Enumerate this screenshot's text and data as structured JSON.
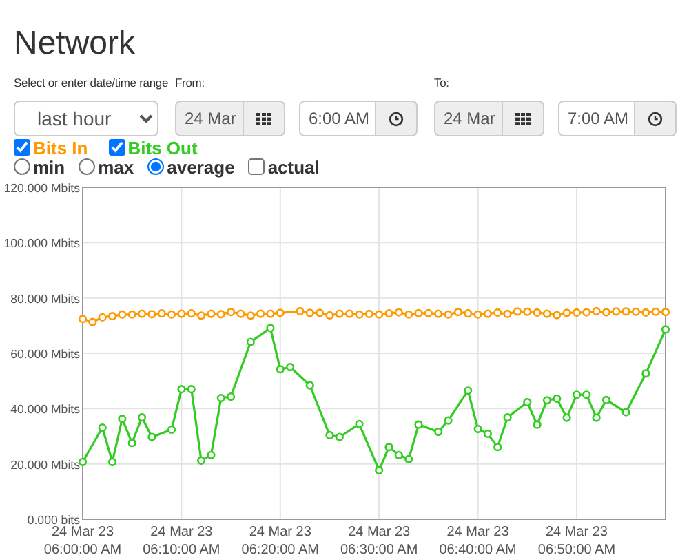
{
  "title": "Network",
  "range": {
    "label": "Select or enter date/time range",
    "value": "last hour"
  },
  "from": {
    "label": "From:",
    "date": "24 Mar",
    "time": "6:00 AM"
  },
  "to": {
    "label": "To:",
    "date": "24 Mar",
    "time": "7:00 AM"
  },
  "legend": [
    {
      "checked": true
    },
    {
      "checked": true
    }
  ],
  "modes": [
    {
      "label": "min",
      "selected": false
    },
    {
      "label": "max",
      "selected": false
    },
    {
      "label": "average",
      "selected": true
    },
    {
      "label": "actual",
      "kind": "checkbox",
      "checked": false
    }
  ],
  "chart_data": {
    "type": "line",
    "categories": [
      "24 Mar 23\n06:00:00 AM",
      null,
      null,
      null,
      null,
      null,
      null,
      null,
      null,
      null,
      "24 Mar 23\n06:10:00 AM",
      null,
      null,
      null,
      null,
      null,
      null,
      null,
      null,
      null,
      "24 Mar 23\n06:20:00 AM",
      null,
      null,
      null,
      null,
      null,
      null,
      null,
      null,
      null,
      "24 Mar 23\n06:30:00 AM",
      null,
      null,
      null,
      null,
      null,
      null,
      null,
      null,
      null,
      "24 Mar 23\n06:40:00 AM",
      null,
      null,
      null,
      null,
      null,
      null,
      null,
      null,
      null,
      "24 Mar 23\n06:50:00 AM",
      null,
      null,
      null,
      null,
      null,
      null,
      null,
      null,
      null
    ],
    "ylim": [
      0,
      120
    ],
    "grid": true,
    "yticks": [
      {
        "value": 0,
        "label": "0.000 bits"
      },
      {
        "value": 20,
        "label": "20.000 Mbits"
      },
      {
        "value": 40,
        "label": "40.000 Mbits"
      },
      {
        "value": 60,
        "label": "60.000 Mbits"
      },
      {
        "value": 80,
        "label": "80.000 Mbits"
      },
      {
        "value": 100,
        "label": "100.000 Mbits"
      },
      {
        "value": 120,
        "label": "120.000 Mbits"
      }
    ],
    "series": [
      {
        "name": "Bits In",
        "color": "#ff9900",
        "marker": "circle",
        "values": [
          72.4,
          71.3,
          73.0,
          73.4,
          74.0,
          74.0,
          74.3,
          74.1,
          74.4,
          74.0,
          74.3,
          74.4,
          73.6,
          74.3,
          74.1,
          74.9,
          74.3,
          73.6,
          74.3,
          74.3,
          74.6,
          null,
          75.2,
          74.6,
          74.6,
          73.7,
          74.3,
          74.3,
          74.0,
          74.2,
          74.0,
          74.4,
          74.8,
          74.0,
          74.5,
          74.5,
          74.3,
          74.0,
          74.9,
          74.4,
          74.0,
          74.3,
          74.7,
          74.2,
          75.1,
          75.0,
          74.7,
          74.3,
          73.8,
          74.6,
          74.7,
          74.8,
          75.2,
          74.8,
          75.1,
          75.1,
          75.0,
          74.7,
          75.0,
          74.9
        ]
      },
      {
        "name": "Bits Out",
        "color": "#33cc22",
        "marker": "circle",
        "values": [
          20.7,
          null,
          33.1,
          20.7,
          36.3,
          27.6,
          36.8,
          29.7,
          null,
          32.4,
          47.0,
          47.0,
          21.2,
          23.2,
          43.8,
          44.3,
          null,
          64.1,
          null,
          69.1,
          54.2,
          55.0,
          null,
          48.4,
          null,
          30.4,
          29.7,
          null,
          34.4,
          null,
          17.7,
          26.1,
          23.2,
          21.7,
          34.2,
          null,
          31.6,
          35.7,
          null,
          46.5,
          32.6,
          30.9,
          26.1,
          36.8,
          null,
          42.3,
          34.2,
          43.0,
          43.6,
          36.7,
          45.0,
          45.0,
          36.7,
          43.1,
          null,
          38.7,
          null,
          52.7,
          null,
          68.6
        ]
      }
    ]
  }
}
